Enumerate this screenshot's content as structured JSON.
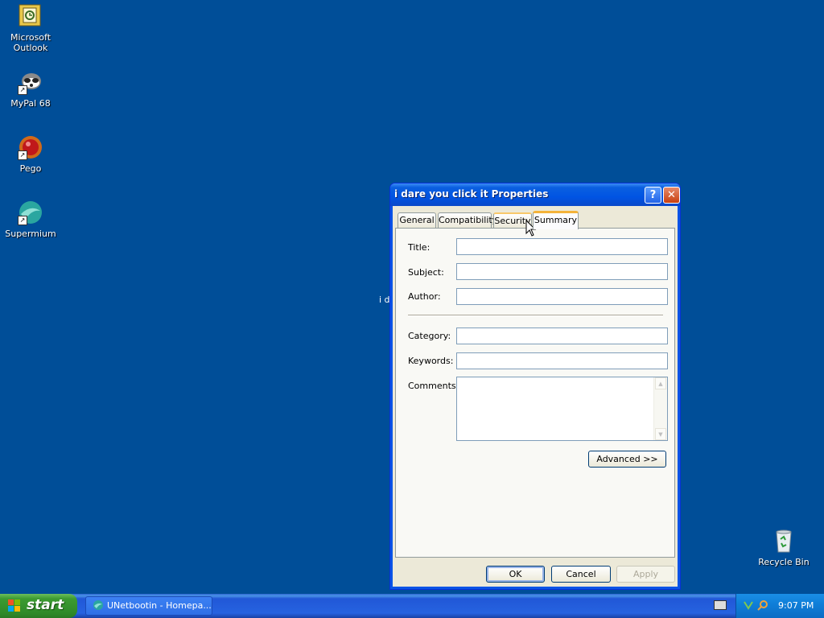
{
  "desktop": {
    "icons": [
      {
        "label": "Microsoft Outlook",
        "icon": "outlook-icon"
      },
      {
        "label": "MyPal 68",
        "icon": "mypal-icon"
      },
      {
        "label": "Pego",
        "icon": "pego-icon"
      },
      {
        "label": "Supermium",
        "icon": "supermium-icon"
      }
    ],
    "recycle_bin": {
      "label": "Recycle Bin",
      "icon": "recycle-bin-icon"
    },
    "stray_text": "i d"
  },
  "dialog": {
    "title": "i dare you click it Properties",
    "help_label": "?",
    "close_label": "✕",
    "tabs": [
      {
        "label": "General"
      },
      {
        "label": "Compatibility"
      },
      {
        "label": "Security"
      },
      {
        "label": "Summary"
      }
    ],
    "selected_tab": "Summary",
    "fields": {
      "title": {
        "label": "Title:",
        "value": ""
      },
      "subject": {
        "label": "Subject:",
        "value": ""
      },
      "author": {
        "label": "Author:",
        "value": ""
      },
      "category": {
        "label": "Category:",
        "value": ""
      },
      "keywords": {
        "label": "Keywords:",
        "value": ""
      },
      "comments": {
        "label": "Comments:",
        "value": ""
      }
    },
    "advanced_label": "Advanced >>",
    "ok_label": "OK",
    "cancel_label": "Cancel",
    "apply_label": "Apply"
  },
  "taskbar": {
    "start_label": "start",
    "task_button_label": "UNetbootin - Homepa...",
    "clock": "9:07 PM"
  },
  "colors": {
    "desktop": "#004e98",
    "titlebar": "#0054e3",
    "dialog_face": "#ece9d8",
    "start_green": "#3c9b31"
  }
}
